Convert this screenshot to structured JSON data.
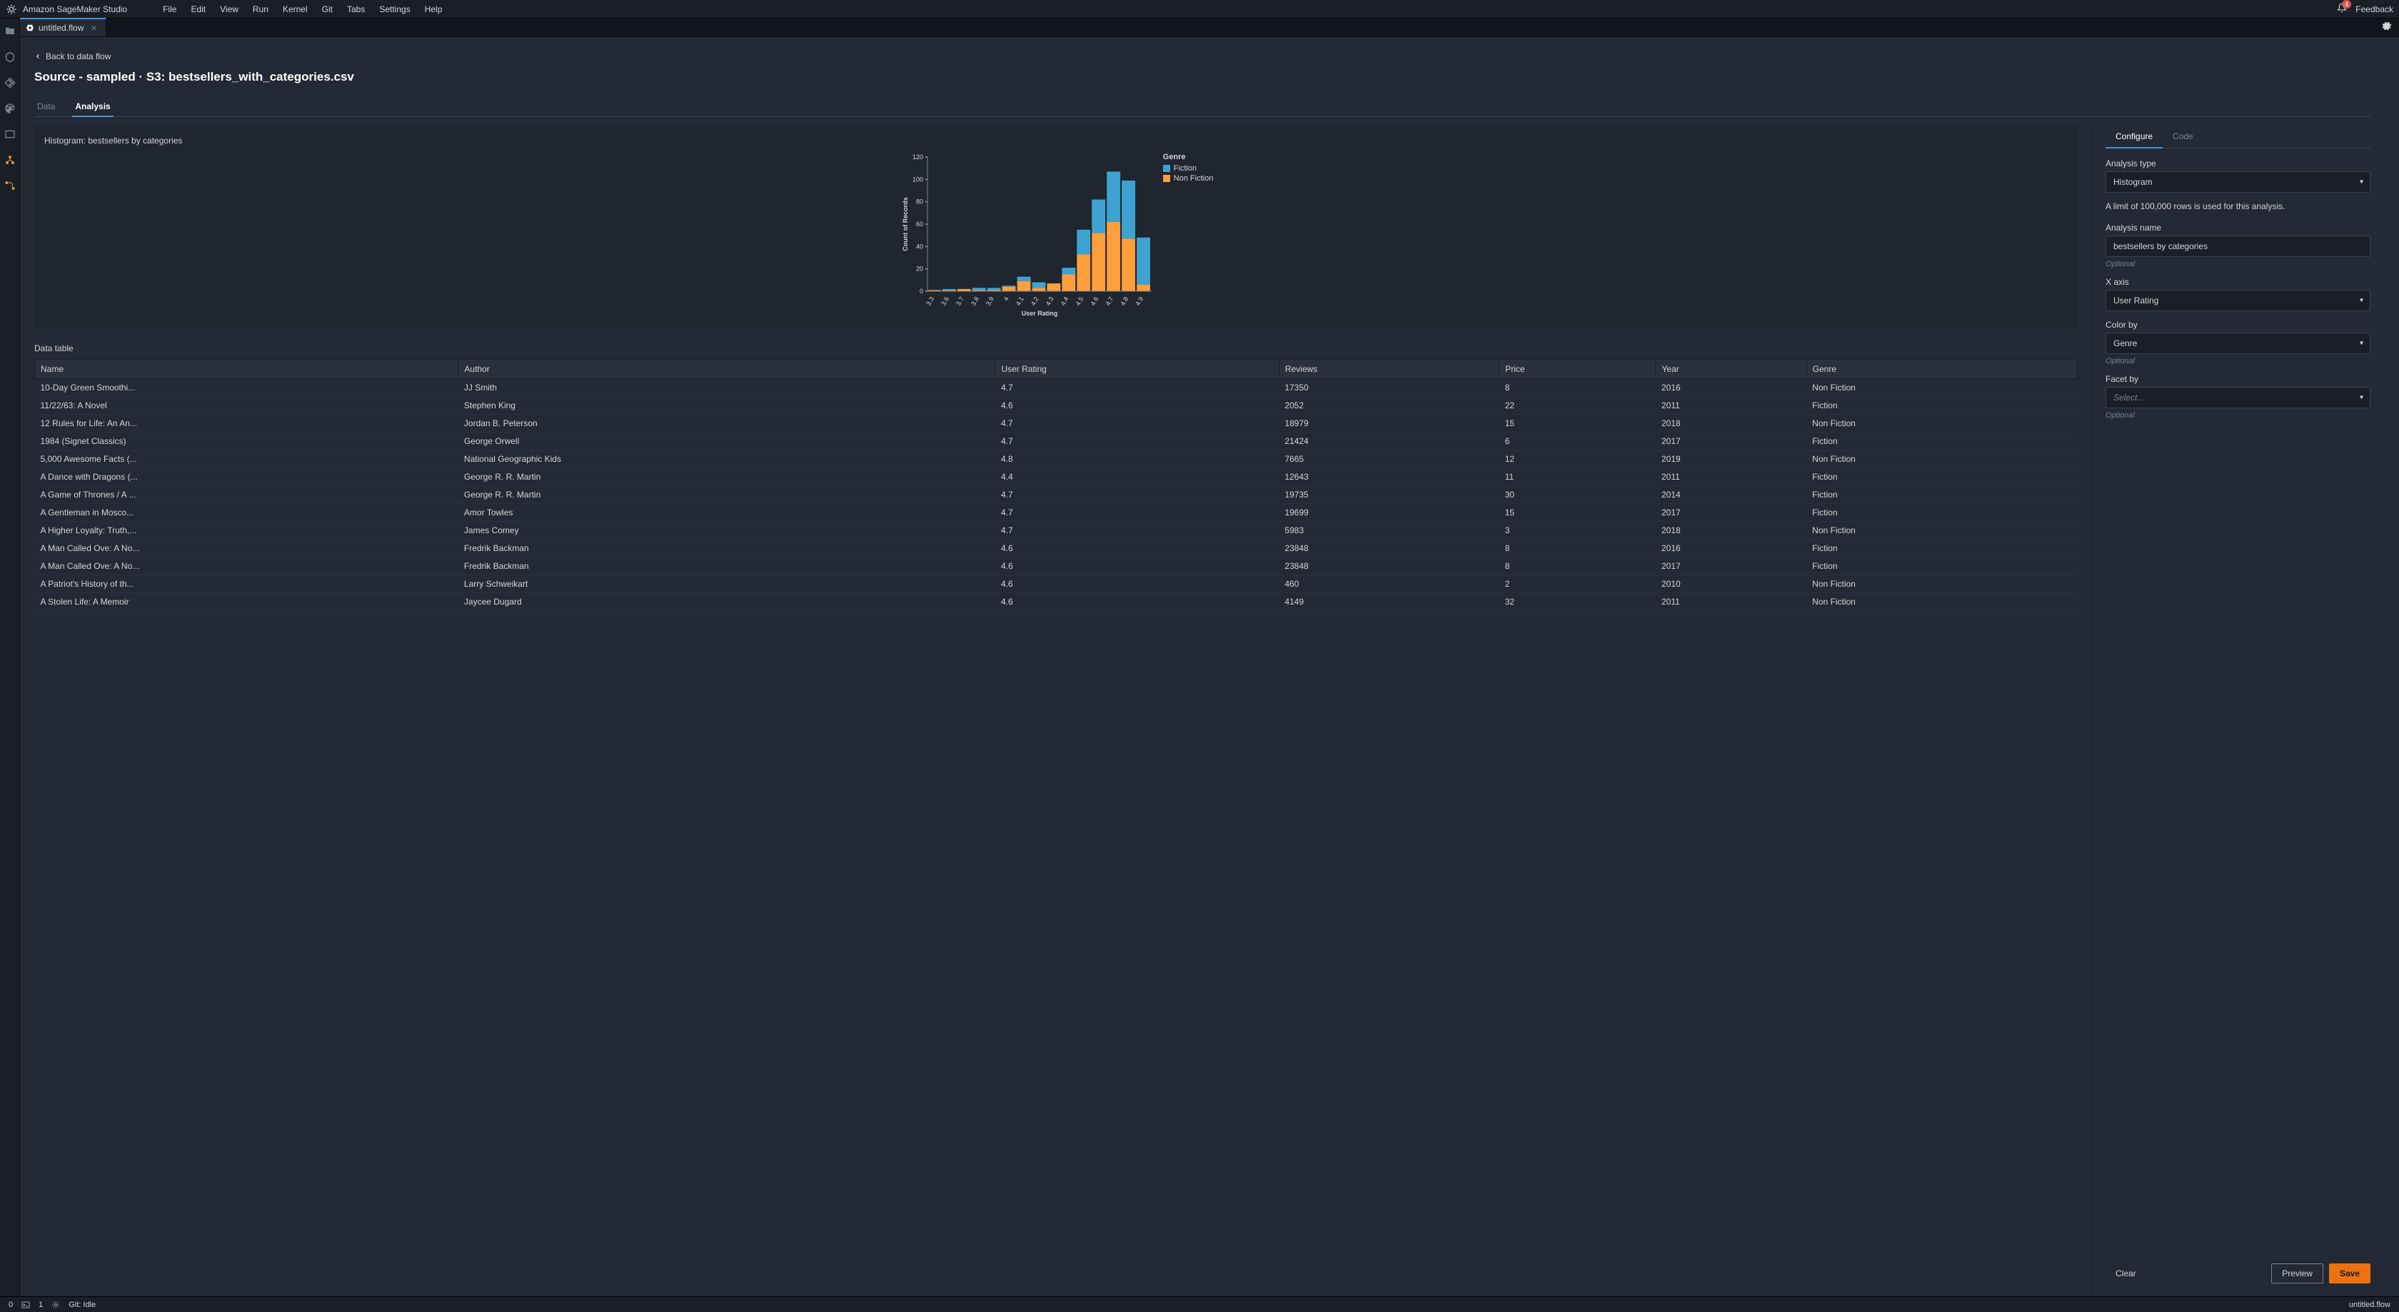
{
  "app": {
    "title": "Amazon SageMaker Studio",
    "menu": [
      "File",
      "Edit",
      "View",
      "Run",
      "Kernel",
      "Git",
      "Tabs",
      "Settings",
      "Help"
    ],
    "notification_count": "4",
    "feedback_label": "Feedback"
  },
  "tabs": [
    {
      "label": "untitled.flow",
      "active": true
    }
  ],
  "breadcrumb_back": "Back to data flow",
  "page_title": "Source - sampled · S3: bestsellers_with_categories.csv",
  "inner_tabs": {
    "data": "Data",
    "analysis": "Analysis",
    "active": "Analysis"
  },
  "chart": {
    "title": "Histogram: bestsellers by categories",
    "legend_title": "Genre",
    "legend": [
      {
        "name": "Fiction",
        "color": "#3fa3d1"
      },
      {
        "name": "Non Fiction",
        "color": "#ff9f3c"
      }
    ]
  },
  "chart_data": {
    "type": "bar",
    "stacked": true,
    "xlabel": "User Rating",
    "ylabel": "Count of Records",
    "ylim": [
      0,
      120
    ],
    "categories": [
      "3.3",
      "3.6",
      "3.7",
      "3.8",
      "3.9",
      "4",
      "4.1",
      "4.2",
      "4.3",
      "4.4",
      "4.5",
      "4.6",
      "4.7",
      "4.8",
      "4.9"
    ],
    "series": [
      {
        "name": "Fiction",
        "color": "#3fa3d1",
        "values": [
          0,
          1,
          0,
          2,
          2,
          1,
          4,
          5,
          0,
          6,
          22,
          30,
          45,
          52,
          42
        ]
      },
      {
        "name": "Non Fiction",
        "color": "#ff9f3c",
        "values": [
          1,
          1,
          2,
          1,
          1,
          4,
          9,
          3,
          7,
          15,
          33,
          52,
          62,
          47,
          6
        ]
      }
    ]
  },
  "data_table": {
    "title": "Data table",
    "columns": [
      "Name",
      "Author",
      "User Rating",
      "Reviews",
      "Price",
      "Year",
      "Genre"
    ],
    "rows": [
      [
        "10-Day Green Smoothi...",
        "JJ Smith",
        "4.7",
        "17350",
        "8",
        "2016",
        "Non Fiction"
      ],
      [
        "11/22/63: A Novel",
        "Stephen King",
        "4.6",
        "2052",
        "22",
        "2011",
        "Fiction"
      ],
      [
        "12 Rules for Life: An An...",
        "Jordan B. Peterson",
        "4.7",
        "18979",
        "15",
        "2018",
        "Non Fiction"
      ],
      [
        "1984 (Signet Classics)",
        "George Orwell",
        "4.7",
        "21424",
        "6",
        "2017",
        "Fiction"
      ],
      [
        "5,000 Awesome Facts (...",
        "National Geographic Kids",
        "4.8",
        "7665",
        "12",
        "2019",
        "Non Fiction"
      ],
      [
        "A Dance with Dragons (...",
        "George R. R. Martin",
        "4.4",
        "12643",
        "11",
        "2011",
        "Fiction"
      ],
      [
        "A Game of Thrones / A ...",
        "George R. R. Martin",
        "4.7",
        "19735",
        "30",
        "2014",
        "Fiction"
      ],
      [
        "A Gentleman in Mosco...",
        "Amor Towles",
        "4.7",
        "19699",
        "15",
        "2017",
        "Fiction"
      ],
      [
        "A Higher Loyalty: Truth,...",
        "James Comey",
        "4.7",
        "5983",
        "3",
        "2018",
        "Non Fiction"
      ],
      [
        "A Man Called Ove: A No...",
        "Fredrik Backman",
        "4.6",
        "23848",
        "8",
        "2016",
        "Fiction"
      ],
      [
        "A Man Called Ove: A No...",
        "Fredrik Backman",
        "4.6",
        "23848",
        "8",
        "2017",
        "Fiction"
      ],
      [
        "A Patriot's History of th...",
        "Larry Schweikart",
        "4.6",
        "460",
        "2",
        "2010",
        "Non Fiction"
      ],
      [
        "A Stolen Life: A Memoir",
        "Jaycee Dugard",
        "4.6",
        "4149",
        "32",
        "2011",
        "Non Fiction"
      ]
    ]
  },
  "config_panel": {
    "tabs": {
      "configure": "Configure",
      "code": "Code",
      "active": "Configure"
    },
    "analysis_type": {
      "label": "Analysis type",
      "value": "Histogram"
    },
    "row_limit_note": "A limit of 100,000 rows is used for this analysis.",
    "analysis_name": {
      "label": "Analysis name",
      "value": "bestsellers by categories",
      "hint": "Optional"
    },
    "x_axis": {
      "label": "X axis",
      "value": "User Rating"
    },
    "color_by": {
      "label": "Color by",
      "value": "Genre",
      "hint": "Optional"
    },
    "facet_by": {
      "label": "Facet by",
      "placeholder": "Select...",
      "hint": "Optional"
    },
    "buttons": {
      "clear": "Clear",
      "preview": "Preview",
      "save": "Save"
    }
  },
  "statusbar": {
    "zero": "0",
    "one": "1",
    "git": "Git: Idle",
    "filename": "untitled.flow"
  }
}
